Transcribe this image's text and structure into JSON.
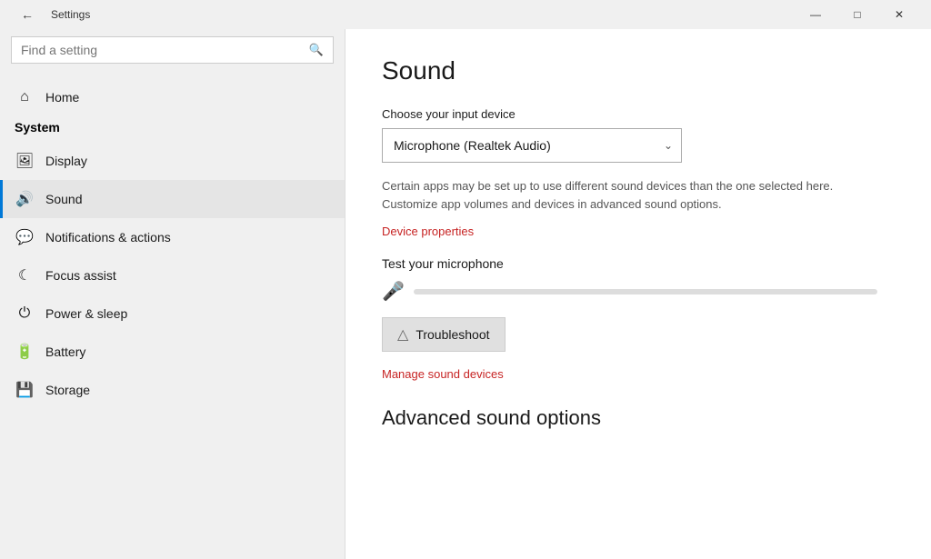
{
  "titlebar": {
    "title": "Settings",
    "minimize": "—",
    "restore": "□",
    "close": "✕"
  },
  "sidebar": {
    "search_placeholder": "Find a setting",
    "system_label": "System",
    "home_label": "Home",
    "nav_items": [
      {
        "id": "display",
        "label": "Display",
        "icon": "🖥"
      },
      {
        "id": "sound",
        "label": "Sound",
        "icon": "🔊",
        "active": true
      },
      {
        "id": "notifications",
        "label": "Notifications & actions",
        "icon": "🗨"
      },
      {
        "id": "focus",
        "label": "Focus assist",
        "icon": "🌙"
      },
      {
        "id": "power",
        "label": "Power & sleep",
        "icon": "⏻"
      },
      {
        "id": "battery",
        "label": "Battery",
        "icon": "🔋"
      },
      {
        "id": "storage",
        "label": "Storage",
        "icon": "💾"
      }
    ]
  },
  "content": {
    "page_title": "Sound",
    "input_section_label": "Choose your input device",
    "device_option": "Microphone (Realtek Audio)",
    "info_text": "Certain apps may be set up to use different sound devices than the one selected here. Customize app volumes and devices in advanced sound options.",
    "device_properties_link": "Device properties",
    "test_label": "Test your microphone",
    "troubleshoot_label": "Troubleshoot",
    "manage_link": "Manage sound devices",
    "advanced_title": "Advanced sound options"
  }
}
